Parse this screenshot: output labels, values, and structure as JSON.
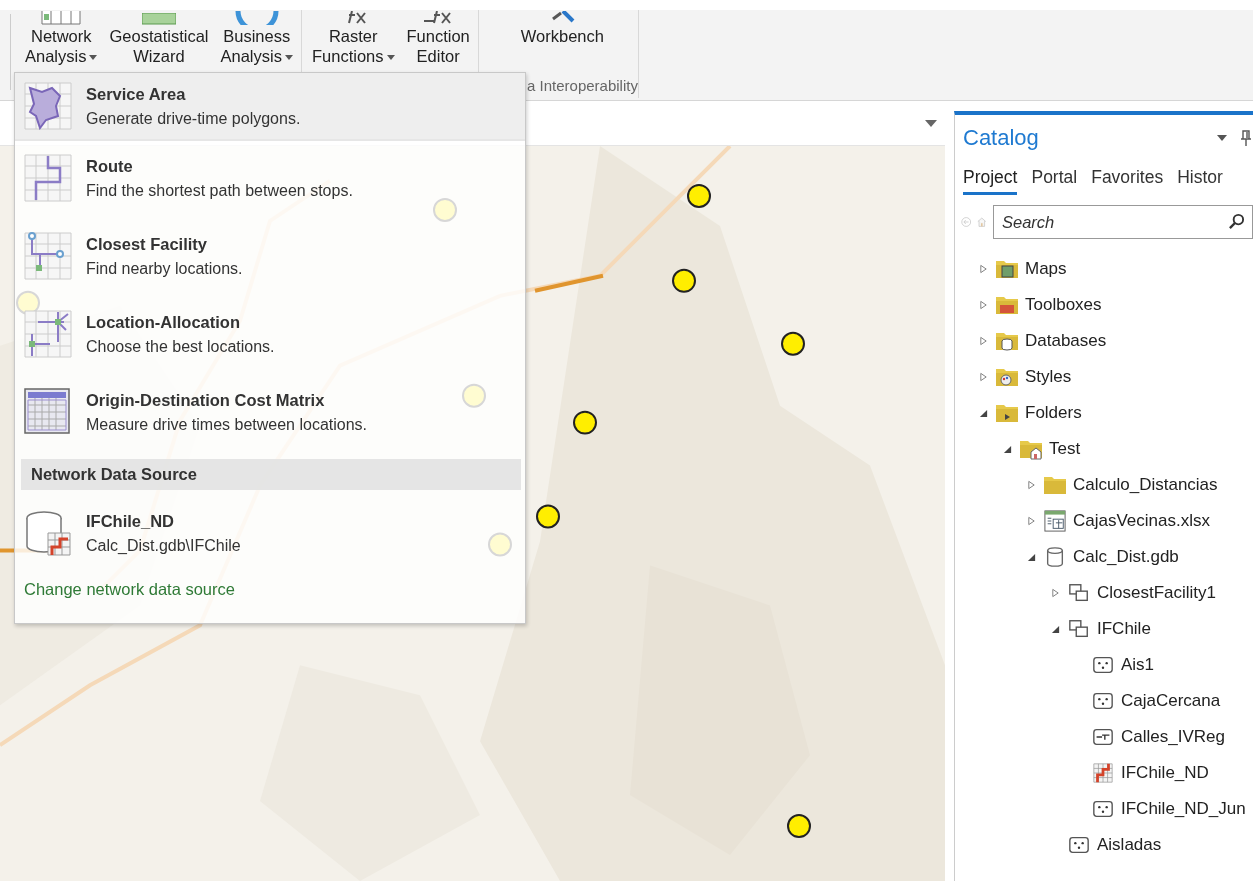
{
  "ribbon": {
    "groups": [
      {
        "buttons": [
          {
            "kind": "network",
            "lines": [
              "Network",
              "Analysis"
            ],
            "dropdown": true
          },
          {
            "kind": "geostat",
            "lines": [
              "Geostatistical",
              "Wizard"
            ],
            "dropdown": false
          },
          {
            "kind": "business",
            "lines": [
              "Business",
              "Analysis"
            ],
            "dropdown": true
          }
        ]
      },
      {
        "buttons": [
          {
            "kind": "function",
            "lines": [
              "Raster",
              "Functions"
            ],
            "dropdown": true
          },
          {
            "kind": "editor",
            "lines": [
              "Function",
              "Editor"
            ],
            "dropdown": false
          }
        ]
      },
      {
        "label": "a Interoperability",
        "buttons": [
          {
            "kind": "workbench",
            "lines": [
              "Workbench"
            ],
            "dropdown": false
          }
        ]
      }
    ]
  },
  "menu": {
    "items": [
      {
        "kind": "service-area",
        "title": "Service Area",
        "description": "Generate drive-time polygons.",
        "highlighted": true
      },
      {
        "kind": "route",
        "title": "Route",
        "description": "Find the shortest path between stops.",
        "highlighted": false
      },
      {
        "kind": "closest",
        "title": "Closest Facility",
        "description": "Find nearby locations.",
        "highlighted": false
      },
      {
        "kind": "allocation",
        "title": "Location-Allocation",
        "description": "Choose the best locations.",
        "highlighted": false
      },
      {
        "kind": "matrix",
        "title": "Origin-Destination Cost Matrix",
        "description": "Measure drive times between locations.",
        "highlighted": false
      }
    ],
    "section": "Network Data Source",
    "source": {
      "title": "IFChile_ND",
      "path": "Calc_Dist.gdb\\IFChile"
    },
    "link": "Change network data source"
  },
  "catalog": {
    "title": "Catalog",
    "tabs": [
      {
        "label": "Project",
        "selected": true
      },
      {
        "label": "Portal",
        "selected": false
      },
      {
        "label": "Favorites",
        "selected": false
      },
      {
        "label": "Histor",
        "selected": false
      }
    ],
    "search": {
      "placeholder": "Search"
    },
    "tree": [
      {
        "kind": "maps",
        "label": "Maps",
        "expanded": false
      },
      {
        "kind": "toolboxes",
        "label": "Toolboxes",
        "expanded": false
      },
      {
        "kind": "databases",
        "label": "Databases",
        "expanded": false
      },
      {
        "kind": "styles",
        "label": "Styles",
        "expanded": false
      },
      {
        "kind": "folders",
        "label": "Folders",
        "expanded": true,
        "children": [
          {
            "kind": "homefolder",
            "label": "Test",
            "expanded": true,
            "children": [
              {
                "kind": "folder",
                "label": "Calculo_Distancias",
                "expanded": false
              },
              {
                "kind": "table",
                "label": "CajasVecinas.xlsx",
                "expanded": false
              },
              {
                "kind": "database",
                "label": "Calc_Dist.gdb",
                "expanded": true,
                "children": [
                  {
                    "kind": "dataset",
                    "label": "ClosestFacility1",
                    "expanded": false
                  },
                  {
                    "kind": "dataset",
                    "label": "IFChile",
                    "expanded": true,
                    "children": [
                      {
                        "kind": "points",
                        "label": "Ais1"
                      },
                      {
                        "kind": "points",
                        "label": "CajaCercana"
                      },
                      {
                        "kind": "lines",
                        "label": "Calles_IVReg"
                      },
                      {
                        "kind": "network",
                        "label": "IFChile_ND"
                      },
                      {
                        "kind": "points",
                        "label": "IFChile_ND_Jun"
                      }
                    ]
                  },
                  {
                    "kind": "points",
                    "label": "Aisladas"
                  }
                ]
              }
            ]
          }
        ]
      }
    ]
  }
}
